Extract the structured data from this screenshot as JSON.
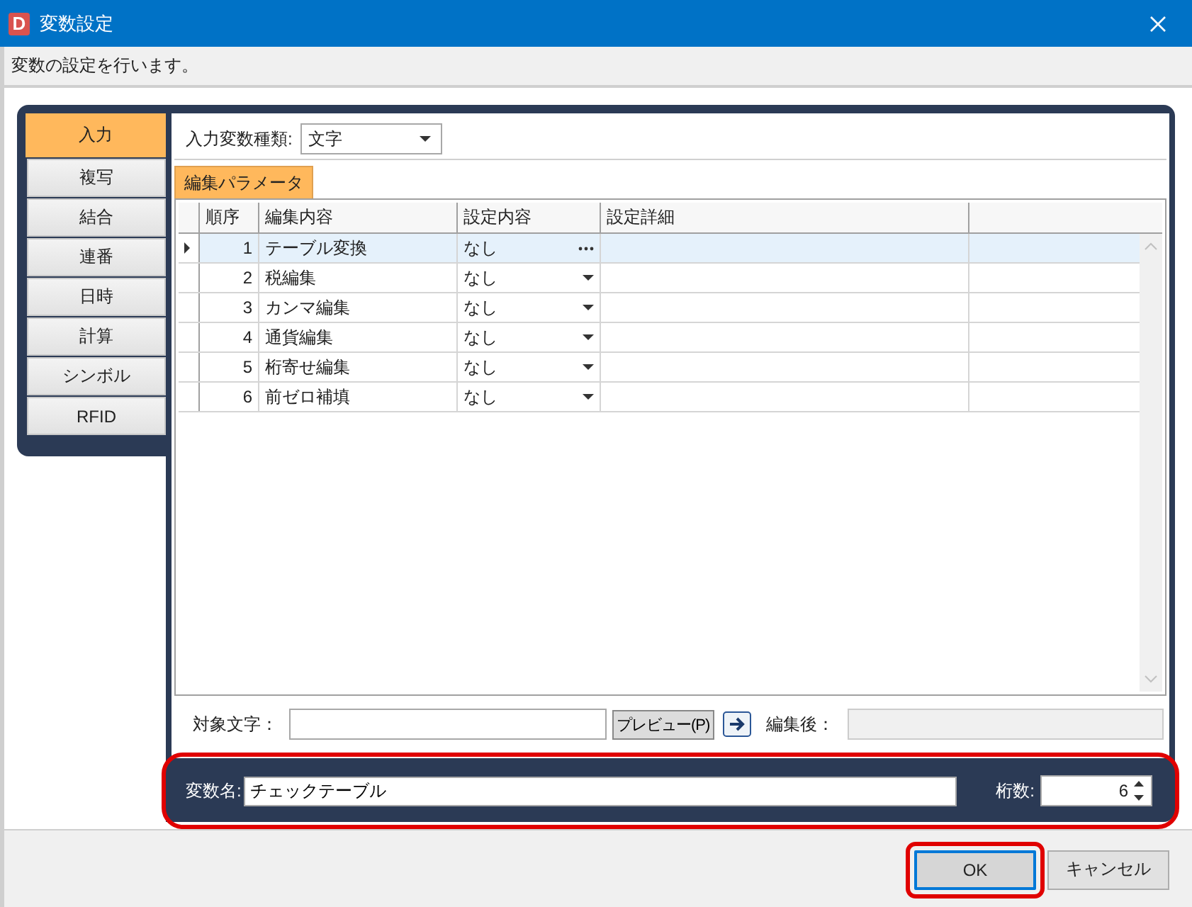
{
  "window": {
    "icon_letter": "D",
    "title": "変数設定"
  },
  "description": "変数の設定を行います。",
  "sidebar": {
    "tabs": [
      {
        "label": "入力",
        "selected": true
      },
      {
        "label": "複写",
        "selected": false
      },
      {
        "label": "結合",
        "selected": false
      },
      {
        "label": "連番",
        "selected": false
      },
      {
        "label": "日時",
        "selected": false
      },
      {
        "label": "計算",
        "selected": false
      },
      {
        "label": "シンボル",
        "selected": false
      },
      {
        "label": "RFID",
        "selected": false
      }
    ]
  },
  "input_type": {
    "label": "入力変数種類:",
    "value": "文字"
  },
  "sub_tabs": [
    {
      "label": "編集パラメータ",
      "selected": true
    }
  ],
  "table": {
    "columns": [
      "順序",
      "編集内容",
      "設定内容",
      "設定詳細"
    ],
    "rows": [
      {
        "order": "1",
        "edit": "テーブル変換",
        "setting": "なし",
        "kind": "ellipsis",
        "selected": true
      },
      {
        "order": "2",
        "edit": "税編集",
        "setting": "なし",
        "kind": "dropdown",
        "selected": false
      },
      {
        "order": "3",
        "edit": "カンマ編集",
        "setting": "なし",
        "kind": "dropdown",
        "selected": false
      },
      {
        "order": "4",
        "edit": "通貨編集",
        "setting": "なし",
        "kind": "dropdown",
        "selected": false
      },
      {
        "order": "5",
        "edit": "桁寄せ編集",
        "setting": "なし",
        "kind": "dropdown",
        "selected": false
      },
      {
        "order": "6",
        "edit": "前ゼロ補填",
        "setting": "なし",
        "kind": "dropdown",
        "selected": false
      }
    ]
  },
  "preview": {
    "target_label": "対象文字：",
    "button": "プレビュー(P)",
    "result_label": "編集後："
  },
  "variable": {
    "name_label": "変数名:",
    "name_value": "チェックテーブル",
    "digits_label": "桁数:",
    "digits_value": "6",
    "highlighted": true
  },
  "buttons": [
    {
      "label": "OK",
      "focused": true,
      "highlighted": true
    },
    {
      "label": "キャンセル",
      "focused": false,
      "highlighted": false
    }
  ]
}
